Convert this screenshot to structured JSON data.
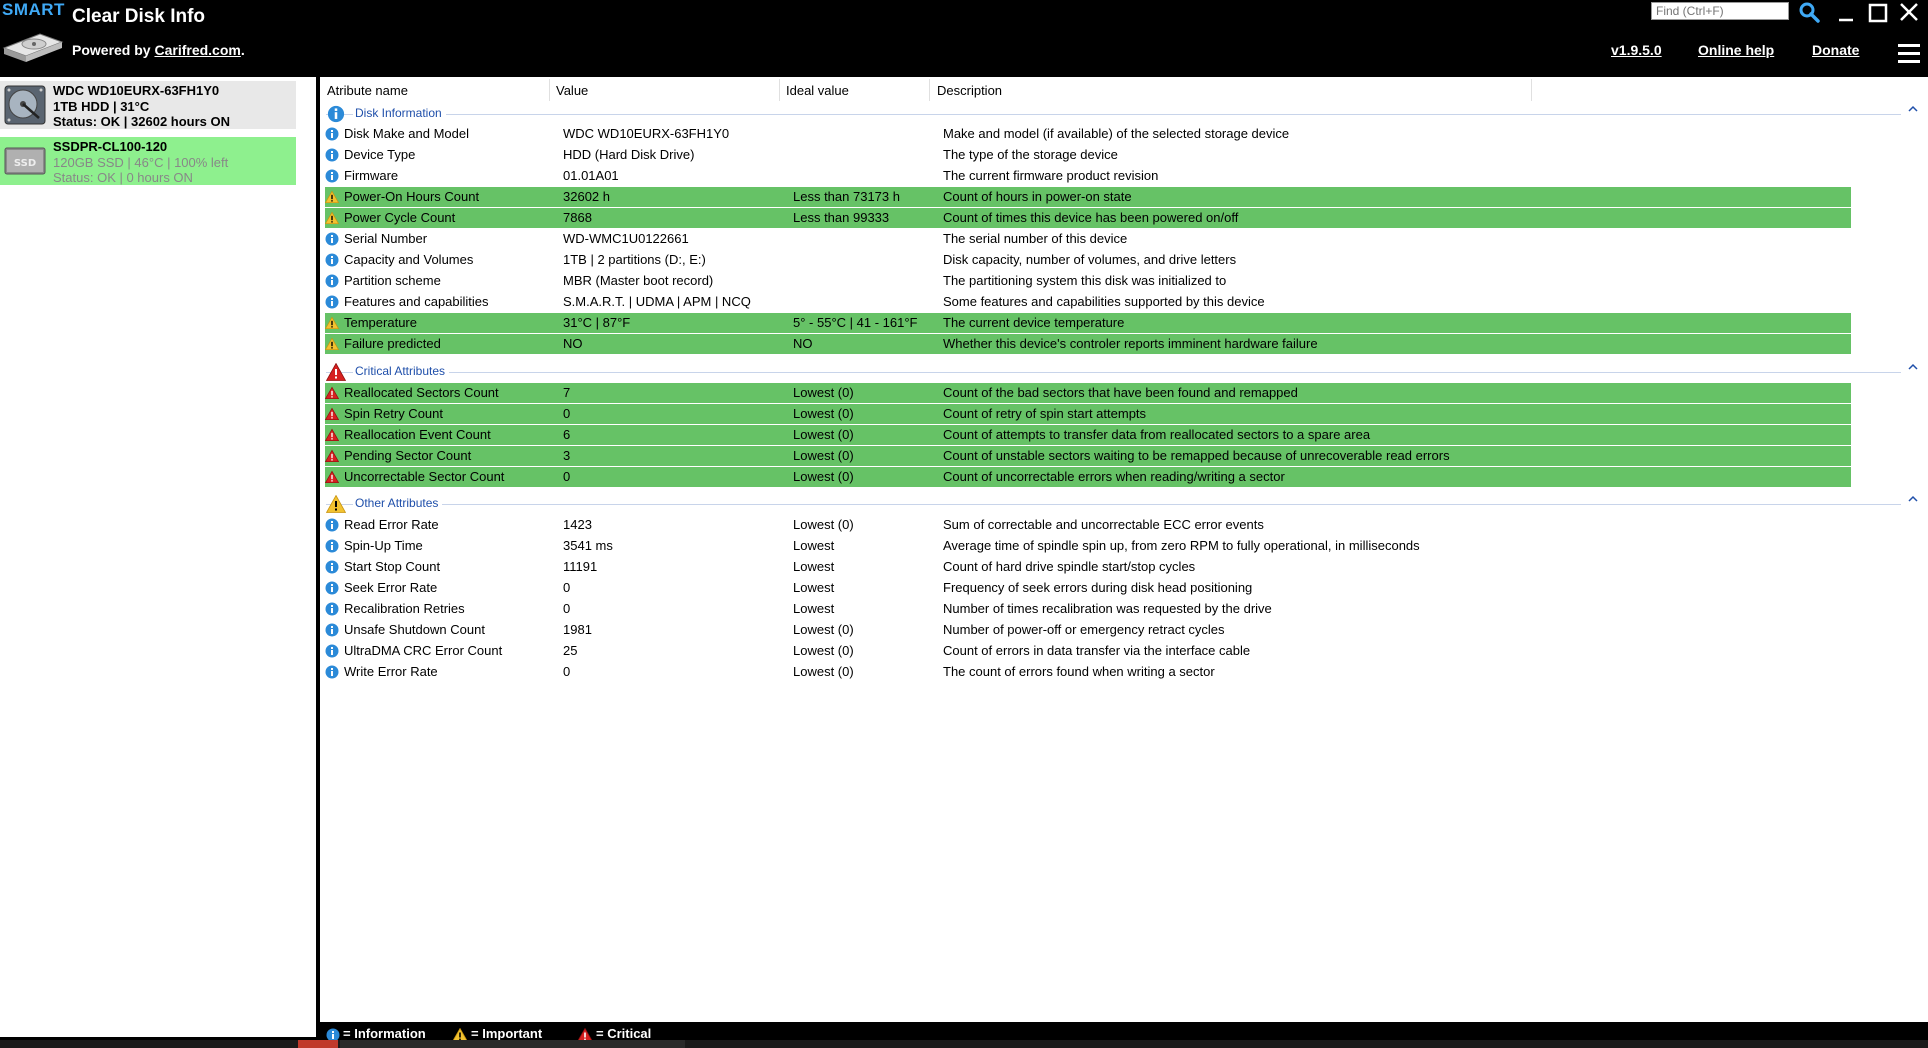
{
  "header": {
    "smart_label": "SMART",
    "app_title": "Clear Disk Info",
    "powered_prefix": "Powered by ",
    "powered_link": "Carifred.com",
    "powered_suffix": ".",
    "find_placeholder": "Find (Ctrl+F)",
    "version": "v1.9.5.0",
    "online_help": "Online help",
    "donate": "Donate"
  },
  "sidebar": {
    "disks": [
      {
        "line1": "WDC WD10EURX-63FH1Y0",
        "line2": "1TB HDD | 31°C",
        "line3": "Status: OK | 32602 hours ON"
      },
      {
        "line1": "SSDPR-CL100-120",
        "line2": "120GB SSD | 46°C | 100% left",
        "line3": "Status: OK | 0 hours ON"
      }
    ]
  },
  "columns": {
    "name": "Atribute name",
    "value": "Value",
    "ideal": "Ideal value",
    "description": "Description"
  },
  "sections": [
    {
      "title": "Disk Information",
      "rows": [
        {
          "name": "Disk Make and Model",
          "value": "WDC WD10EURX-63FH1Y0",
          "ideal": "",
          "description": "Make and model (if available) of the selected storage device"
        },
        {
          "name": "Device Type",
          "value": "HDD (Hard Disk Drive)",
          "ideal": "",
          "description": "The type of the storage device"
        },
        {
          "name": "Firmware",
          "value": "01.01A01",
          "ideal": "",
          "description": "The current firmware product revision"
        },
        {
          "name": "Power-On Hours Count",
          "value": "32602 h",
          "ideal": "Less than 73173 h",
          "description": "Count of hours in power-on state"
        },
        {
          "name": "Power Cycle Count",
          "value": "7868",
          "ideal": "Less than 99333",
          "description": "Count of times this device has been powered on/off"
        },
        {
          "name": "Serial Number",
          "value": "WD-WMC1U0122661",
          "ideal": "",
          "description": "The serial number of this device"
        },
        {
          "name": "Capacity and Volumes",
          "value": "1TB | 2 partitions (D:, E:)",
          "ideal": "",
          "description": "Disk capacity, number of volumes, and drive letters"
        },
        {
          "name": "Partition scheme",
          "value": "MBR (Master boot record)",
          "ideal": "",
          "description": "The partitioning system this disk was initialized to"
        },
        {
          "name": "Features and capabilities",
          "value": "S.M.A.R.T. | UDMA | APM | NCQ",
          "ideal": "",
          "description": "Some features and capabilities supported by this device"
        },
        {
          "name": "Temperature",
          "value": "31°C | 87°F",
          "ideal": "5° - 55°C | 41 - 161°F",
          "description": "The current device temperature"
        },
        {
          "name": "Failure predicted",
          "value": "NO",
          "ideal": "NO",
          "description": "Whether this device's controler reports imminent hardware failure"
        }
      ]
    },
    {
      "title": "Critical Attributes",
      "rows": [
        {
          "name": "Reallocated Sectors Count",
          "value": "7",
          "ideal": "Lowest (0)",
          "description": "Count of the bad sectors that have been found and remapped"
        },
        {
          "name": "Spin Retry Count",
          "value": "0",
          "ideal": "Lowest (0)",
          "description": "Count of retry of spin start attempts"
        },
        {
          "name": "Reallocation Event Count",
          "value": "6",
          "ideal": "Lowest (0)",
          "description": "Count of attempts to transfer data from reallocated sectors to a spare area"
        },
        {
          "name": "Pending Sector Count",
          "value": "3",
          "ideal": "Lowest (0)",
          "description": "Count of unstable sectors waiting to be remapped because of unrecoverable read errors"
        },
        {
          "name": "Uncorrectable Sector Count",
          "value": "0",
          "ideal": "Lowest (0)",
          "description": "Count of uncorrectable errors when reading/writing a sector"
        }
      ]
    },
    {
      "title": "Other Attributes",
      "rows": [
        {
          "name": "Read Error Rate",
          "value": "1423",
          "ideal": "Lowest (0)",
          "description": "Sum of correctable and uncorrectable ECC error events"
        },
        {
          "name": "Spin-Up Time",
          "value": "3541 ms",
          "ideal": "Lowest",
          "description": "Average time of spindle spin up, from zero RPM to fully operational, in milliseconds"
        },
        {
          "name": "Start Stop Count",
          "value": "11191",
          "ideal": "Lowest",
          "description": "Count of hard drive spindle start/stop cycles"
        },
        {
          "name": "Seek Error Rate",
          "value": "0",
          "ideal": "Lowest",
          "description": "Frequency of seek errors during disk head positioning"
        },
        {
          "name": "Recalibration Retries",
          "value": "0",
          "ideal": "Lowest",
          "description": "Number of times recalibration was requested by the drive"
        },
        {
          "name": "Unsafe Shutdown Count",
          "value": "1981",
          "ideal": "Lowest (0)",
          "description": "Number of power-off or emergency retract cycles"
        },
        {
          "name": "UltraDMA CRC Error Count",
          "value": "25",
          "ideal": "Lowest (0)",
          "description": "Count of errors in data transfer via the interface cable"
        },
        {
          "name": "Write Error Rate",
          "value": "0",
          "ideal": "Lowest (0)",
          "description": "The count of errors found when writing a sector"
        }
      ]
    }
  ],
  "legend": {
    "information": "= Information",
    "important": "= Important",
    "critical": "= Critical"
  },
  "colors": {
    "highlight": "#66c266",
    "ssd_selected": "#8ef08e",
    "info_blue": "#2b8ad8",
    "warning_yellow": "#f2c230",
    "critical_red": "#d62020",
    "section_title": "#1f4faa"
  }
}
